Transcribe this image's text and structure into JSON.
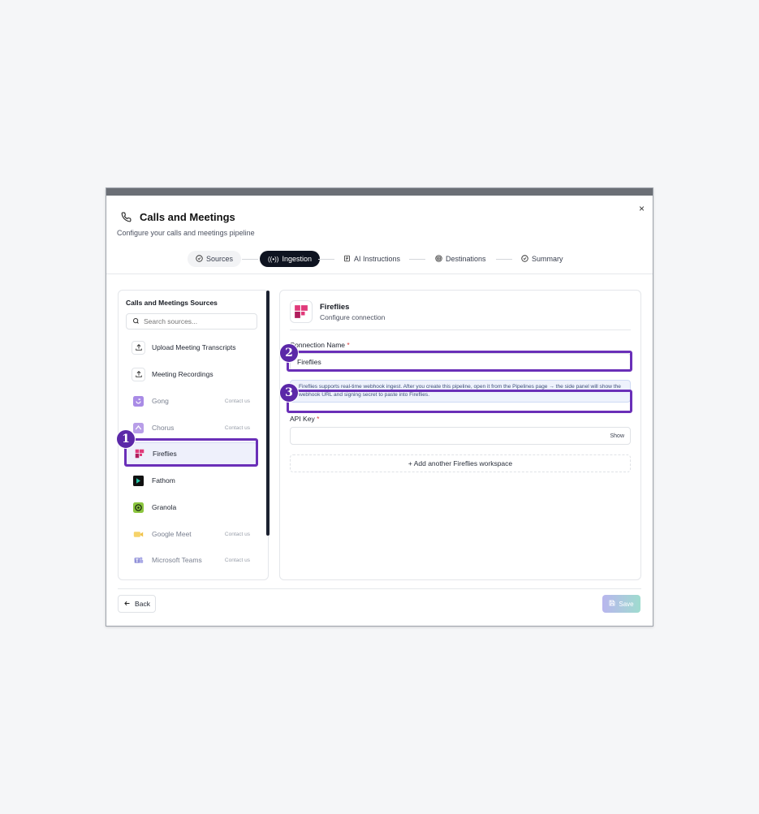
{
  "dialog": {
    "title": "Calls and Meetings",
    "subtitle": "Configure your calls and meetings pipeline",
    "close_label": "×"
  },
  "stepper": {
    "steps": [
      {
        "label": "Sources",
        "state": "done",
        "icon": "check-circle-icon"
      },
      {
        "label": "Ingestion",
        "state": "active",
        "icon": "broadcast-icon"
      },
      {
        "label": "AI Instructions",
        "state": "pending",
        "icon": "ai-doc-icon"
      },
      {
        "label": "Destinations",
        "state": "pending",
        "icon": "target-icon"
      },
      {
        "label": "Summary",
        "state": "pending",
        "icon": "check-circle-icon"
      }
    ]
  },
  "sources_panel": {
    "title": "Calls and Meetings Sources",
    "search_placeholder": "Search sources...",
    "items": [
      {
        "label": "Upload Meeting Transcripts",
        "icon": "upload-icon",
        "contact": ""
      },
      {
        "label": "Meeting Recordings",
        "icon": "upload-icon",
        "contact": ""
      },
      {
        "label": "Gong",
        "icon": "gong-logo-icon",
        "contact": "Contact us"
      },
      {
        "label": "Chorus",
        "icon": "chorus-logo-icon",
        "contact": "Contact us"
      },
      {
        "label": "Fireflies",
        "icon": "fireflies-logo-icon",
        "contact": ""
      },
      {
        "label": "Fathom",
        "icon": "fathom-logo-icon",
        "contact": ""
      },
      {
        "label": "Granola",
        "icon": "granola-logo-icon",
        "contact": ""
      },
      {
        "label": "Google Meet",
        "icon": "google-meet-logo-icon",
        "contact": "Contact us"
      },
      {
        "label": "Microsoft Teams",
        "icon": "teams-logo-icon",
        "contact": "Contact us"
      }
    ],
    "selected": "Fireflies"
  },
  "config_panel": {
    "title": "Fireflies",
    "subtitle": "Configure connection",
    "connection_name_label": "Connection Name",
    "connection_name_value": "Fireflies",
    "info_text": "Fireflies supports real-time webhook ingest. After you create this pipeline, open it from the Pipelines page → the side panel will show the webhook URL and signing secret to paste into Fireflies.",
    "api_key_label": "API Key",
    "api_key_value": "",
    "show_label": "Show",
    "add_workspace_label": "+ Add another Fireflies workspace",
    "required_mark": "*"
  },
  "footer": {
    "back_label": "Back",
    "save_label": "Save"
  },
  "annotations": [
    {
      "number": "1",
      "target": "fireflies source item"
    },
    {
      "number": "2",
      "target": "connection name input"
    },
    {
      "number": "3",
      "target": "webhook info box"
    }
  ],
  "colors": {
    "accent_dark": "#0e1320",
    "annotation_purple": "#6a2fb8",
    "fireflies_brand": "#d8286a"
  }
}
